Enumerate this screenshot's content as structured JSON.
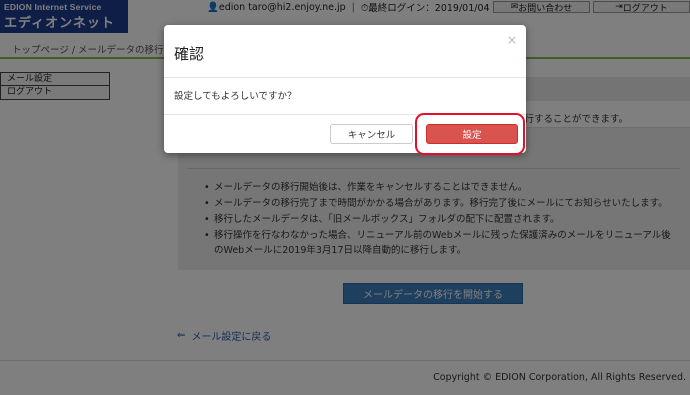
{
  "header": {
    "logo_small": "EDION Internet Service",
    "logo_big": "エディオンネット",
    "user_email": "edion taro@hi2.enjoy.ne.jp",
    "last_login_label": "最終ログイン：2019/01/04　16:42:14",
    "contact_label": "お問い合わせ",
    "logout_label": "ログアウト"
  },
  "breadcrumb": "トップページ / メールデータの移行",
  "sidebar": {
    "items": [
      {
        "label": "メール設定"
      },
      {
        "label": "ログアウト"
      }
    ]
  },
  "main": {
    "description": "移行することができます。",
    "notes": [
      "メールデータの移行開始後は、作業をキャンセルすることはできません。",
      "メールデータの移行完了まで時間がかかる場合があります。移行完了後にメールにてお知らせいたします。",
      "移行したメールデータは、「旧メールボックス」フォルダの配下に配置されます。",
      "移行操作を行なわなかった場合、リニューアル前のWebメールに残った保護済みのメールをリニューアル後のWebメールに2019年3月17日以降自動的に移行します。"
    ],
    "start_button": "メールデータの移行を開始する",
    "back_link": "メール設定に戻る"
  },
  "footer": {
    "copyright": "Copyright © EDION Corporation, All Rights Reserved."
  },
  "modal": {
    "title": "確認",
    "close": "×",
    "message": "設定してもよろしいですか？",
    "cancel_label": "キャンセル",
    "ok_label": "設定"
  },
  "colors": {
    "brand": "#1f3d8f",
    "accent_green": "#7bbd4a",
    "primary_button": "#3e7fbf",
    "danger_button": "#d9534f",
    "highlight": "#e3102b"
  }
}
